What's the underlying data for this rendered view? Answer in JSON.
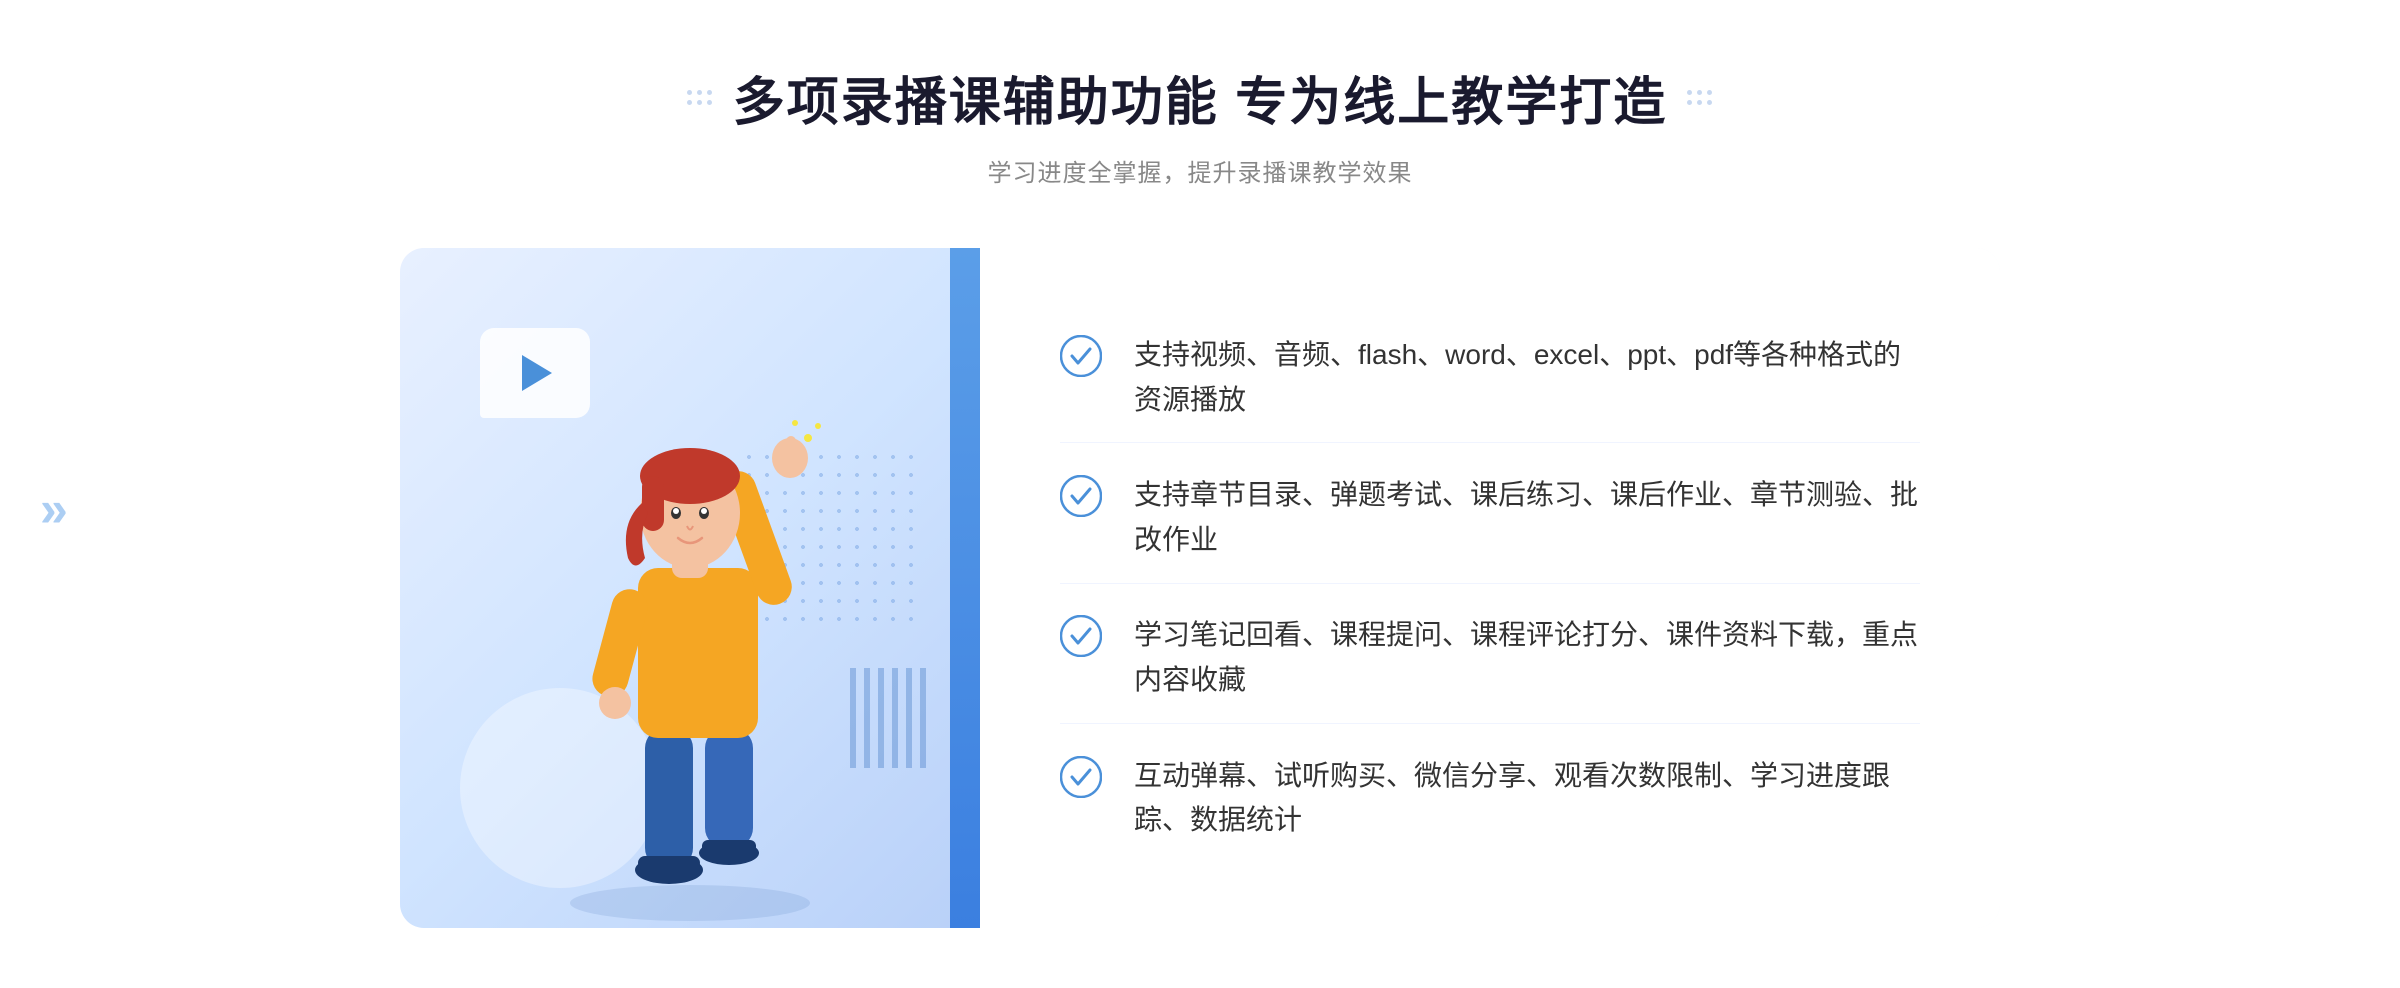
{
  "header": {
    "title": "多项录播课辅助功能 专为线上教学打造",
    "subtitle": "学习进度全掌握，提升录播课教学效果"
  },
  "features": [
    {
      "id": 1,
      "text": "支持视频、音频、flash、word、excel、ppt、pdf等各种格式的资源播放"
    },
    {
      "id": 2,
      "text": "支持章节目录、弹题考试、课后练习、课后作业、章节测验、批改作业"
    },
    {
      "id": 3,
      "text": "学习笔记回看、课程提问、课程评论打分、课件资料下载，重点内容收藏"
    },
    {
      "id": 4,
      "text": "互动弹幕、试听购买、微信分享、观看次数限制、学习进度跟踪、数据统计"
    }
  ],
  "colors": {
    "primary": "#4a90d9",
    "secondary": "#5b9ee8",
    "accent": "#3b7fe0",
    "text_dark": "#1a1a2e",
    "text_medium": "#333333",
    "text_light": "#888888"
  },
  "icons": {
    "check": "check-circle-icon",
    "play": "play-icon",
    "arrow_left": "chevron-left-icon"
  }
}
